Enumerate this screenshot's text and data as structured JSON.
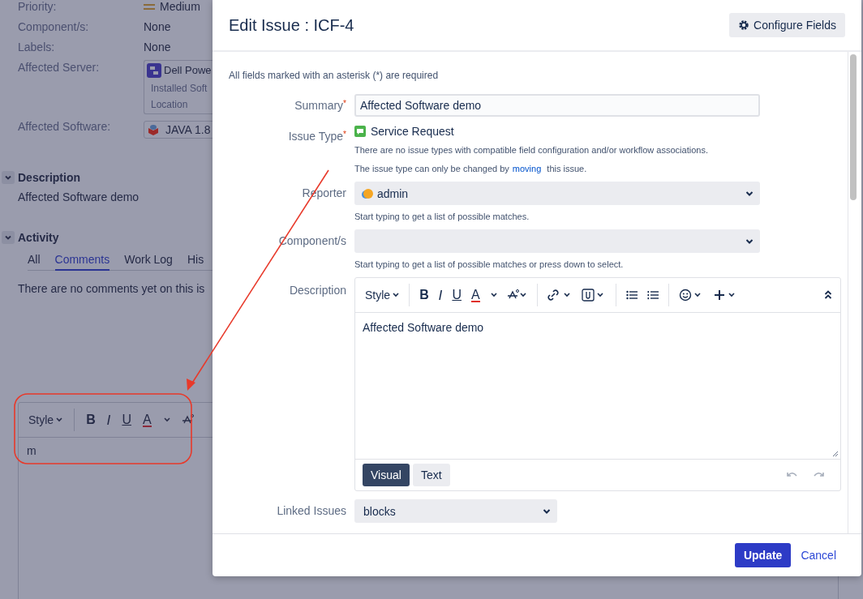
{
  "background": {
    "fields": [
      {
        "label": "Priority:",
        "kind": "priority",
        "value": "Medium"
      },
      {
        "label": "Component/s:",
        "kind": "text",
        "value": "None"
      },
      {
        "label": "Labels:",
        "kind": "text",
        "value": "None"
      },
      {
        "label": "Affected Server:",
        "kind": "server",
        "value": "Dell Powe",
        "lines": [
          "Installed Soft",
          "Location"
        ]
      },
      {
        "label": "Affected Software:",
        "kind": "software",
        "value": "JAVA 1.8"
      }
    ],
    "description": {
      "title": "Description",
      "expanded": true,
      "text": "Affected Software demo"
    },
    "activity": {
      "title": "Activity",
      "expanded": true,
      "tabs": [
        {
          "label": "All",
          "selected": false
        },
        {
          "label": "Comments",
          "selected": true
        },
        {
          "label": "Work Log",
          "selected": false
        },
        {
          "label": "His",
          "selected": false
        }
      ],
      "empty_text": "There are no comments yet on this is"
    },
    "comment_editor": {
      "style_label": "Style",
      "bold": "B",
      "italic": "I",
      "underline": "U",
      "text_color_label": "A",
      "text": "m"
    }
  },
  "modal": {
    "title": "Edit Issue : ICF-4",
    "configure_button": "Configure Fields",
    "required_note": "All fields marked with an asterisk (*) are required",
    "fields": [
      {
        "label": "Summary",
        "required_mark": "*",
        "kind": "input",
        "value": "Affected Software demo"
      },
      {
        "label": "Issue Type",
        "required_mark": "*",
        "kind": "issue_type",
        "value": "Service Request",
        "notes": [
          {
            "before": "There are no issue types with compatible field configuration and/or workflow associations."
          },
          {
            "before": "The issue type can only be changed by",
            "link": "moving",
            "after": "this issue."
          }
        ]
      },
      {
        "label": "Reporter",
        "kind": "select",
        "value": "admin",
        "avatar": true,
        "help": "Start typing to get a list of possible matches."
      },
      {
        "label": "Component/s",
        "kind": "select",
        "help": "Start typing to get a list of possible matches or press down to select."
      },
      {
        "label": "Description",
        "kind": "editor",
        "style_label": "Style",
        "bold": "B",
        "italic": "I",
        "underline": "U",
        "text_color_label": "A",
        "text": "Affected Software demo",
        "modes": [
          {
            "label": "Visual",
            "selected": true
          },
          {
            "label": "Text",
            "selected": false
          }
        ]
      },
      {
        "label": "Linked Issues",
        "kind": "select_short",
        "value": "blocks"
      }
    ],
    "update_button": "Update",
    "cancel_link": "Cancel"
  }
}
